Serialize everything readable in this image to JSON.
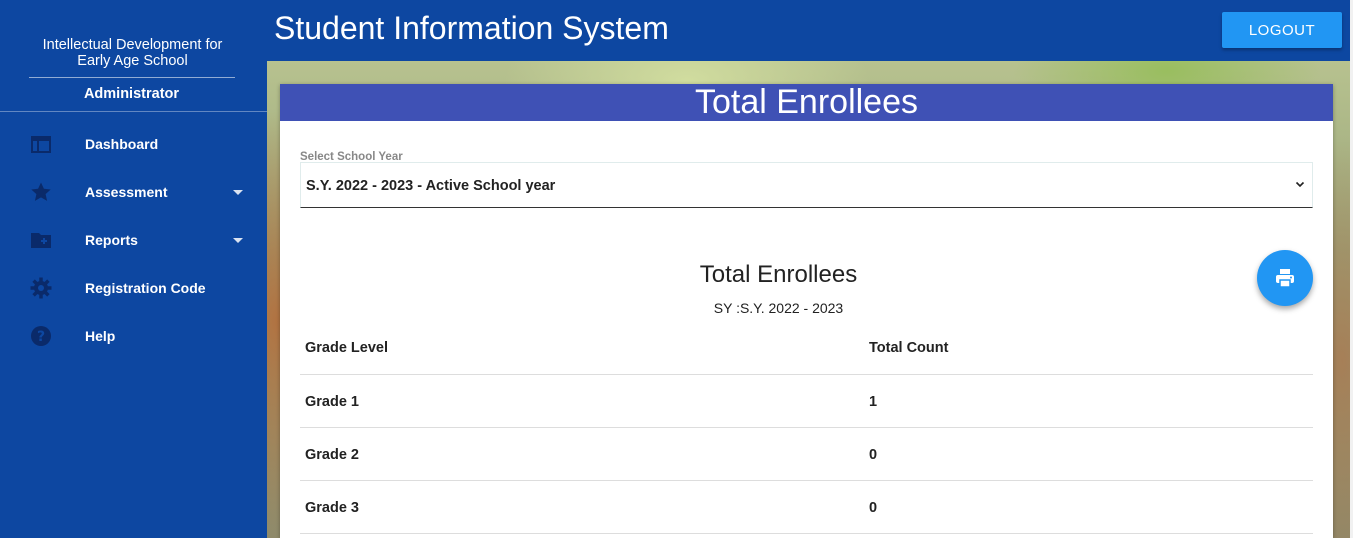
{
  "sidebar": {
    "school_name": "Intellectual Development for Early Age School",
    "role": "Administrator",
    "items": [
      {
        "label": "Dashboard",
        "icon": "dashboard-icon",
        "has_submenu": false
      },
      {
        "label": "Assessment",
        "icon": "star-icon",
        "has_submenu": true
      },
      {
        "label": "Reports",
        "icon": "folder-add-icon",
        "has_submenu": true
      },
      {
        "label": "Registration Code",
        "icon": "gear-icon",
        "has_submenu": false
      },
      {
        "label": "Help",
        "icon": "help-icon",
        "has_submenu": false
      }
    ]
  },
  "header": {
    "title": "Student Information System",
    "logout_label": "LOGOUT"
  },
  "card": {
    "header_title": "Total Enrollees",
    "select_label": "Select School Year",
    "select_value": "S.Y. 2022 - 2023 - Active School year",
    "report_title": "Total Enrollees",
    "report_subtitle": "SY :S.Y. 2022 - 2023",
    "print_icon": "print-icon",
    "table": {
      "columns": [
        "Grade Level",
        "Total Count"
      ],
      "rows": [
        [
          "Grade 1",
          "1"
        ],
        [
          "Grade 2",
          "0"
        ],
        [
          "Grade 3",
          "0"
        ]
      ]
    }
  },
  "colors": {
    "sidebar": "#0d47a1",
    "card_header": "#3f51b5",
    "accent": "#2196f3"
  }
}
